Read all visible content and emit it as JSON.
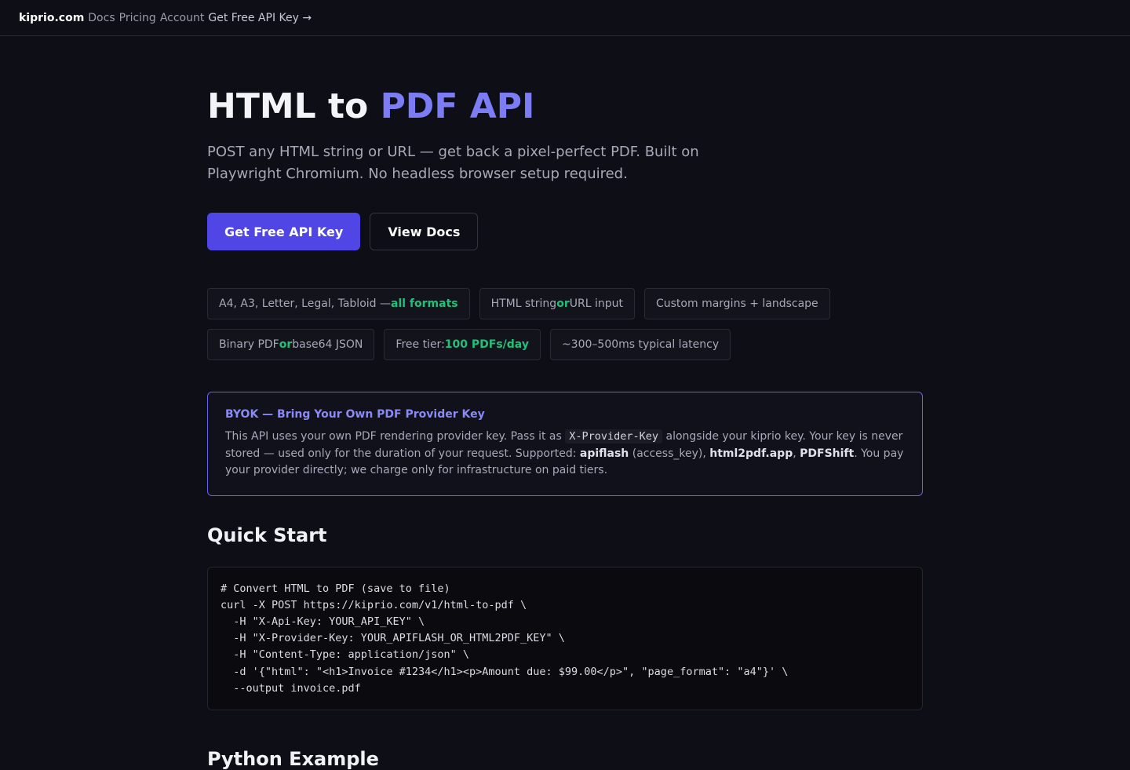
{
  "nav": {
    "brand": "kiprio.com",
    "links": [
      "Docs",
      "Pricing",
      "Account"
    ],
    "cta": "Get Free API Key →"
  },
  "hero": {
    "title_prefix": "HTML to ",
    "title_accent": "PDF API",
    "subtitle": "POST any HTML string or URL — get back a pixel-perfect PDF. Built on Playwright Chromium. No headless browser setup required.",
    "primary_button": "Get Free API Key",
    "secondary_button": "View Docs"
  },
  "features": [
    {
      "pre": "A4, A3, Letter, Legal, Tabloid — ",
      "hl": "all formats",
      "post": ""
    },
    {
      "pre": "HTML string ",
      "hl": "or",
      "post": " URL input"
    },
    {
      "pre": "Custom margins + landscape",
      "hl": "",
      "post": ""
    },
    {
      "pre": "Binary PDF ",
      "hl": "or",
      "post": " base64 JSON"
    },
    {
      "pre": "Free tier: ",
      "hl": "100 PDFs/day",
      "post": ""
    },
    {
      "pre": "~300–500ms typical latency",
      "hl": "",
      "post": ""
    }
  ],
  "byok": {
    "title": "BYOK — Bring Your Own PDF Provider Key",
    "text_1": "This API uses your own PDF rendering provider key. Pass it as ",
    "header_name": "X-Provider-Key",
    "text_2": " alongside your kiprio key. Your key is never stored — used only for the duration of your request. Supported: ",
    "provider_1": "apiflash",
    "provider_1_note": " (access_key), ",
    "provider_2": "html2pdf.app",
    "sep": ", ",
    "provider_3": "PDFShift",
    "text_3": ". You pay your provider directly; we charge only for infrastructure on paid tiers."
  },
  "quick_start": {
    "heading": "Quick Start",
    "code": "# Convert HTML to PDF (save to file)\ncurl -X POST https://kiprio.com/v1/html-to-pdf \\\n  -H \"X-Api-Key: YOUR_API_KEY\" \\\n  -H \"X-Provider-Key: YOUR_APIFLASH_OR_HTML2PDF_KEY\" \\\n  -H \"Content-Type: application/json\" \\\n  -d '{\"html\": \"<h1>Invoice #1234</h1><p>Amount due: $99.00</p>\", \"page_format\": \"a4\"}' \\\n  --output invoice.pdf"
  },
  "python": {
    "heading": "Python Example"
  },
  "colors": {
    "background": "#0e0e16",
    "accent": "#7c7cf4",
    "primary_button": "#4f46e5",
    "highlight_green": "#22c07a",
    "byok_border": "#6464e8"
  }
}
